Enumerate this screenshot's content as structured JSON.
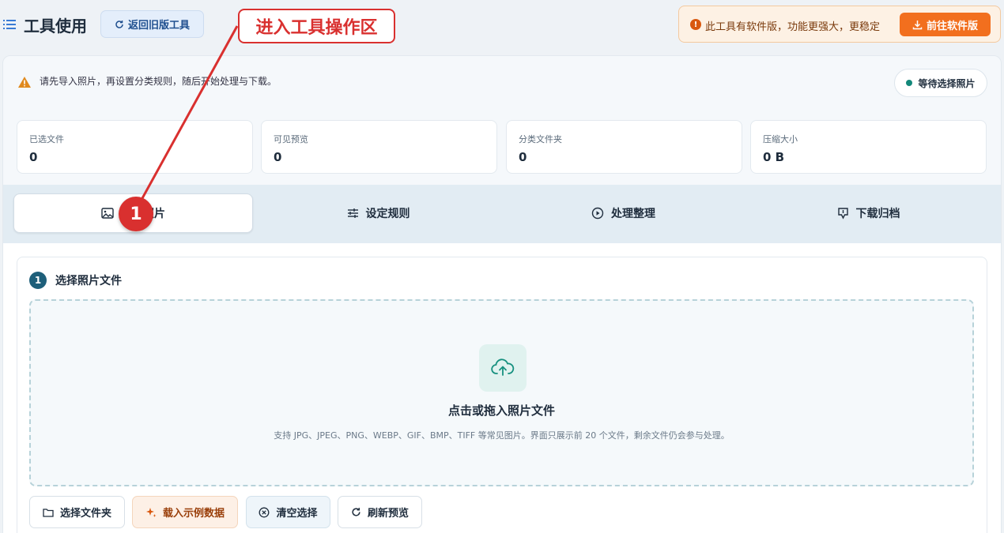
{
  "header": {
    "title": "工具使用",
    "back_label": "返回旧版工具",
    "promo_text": "此工具有软件版，功能更强大，更稳定",
    "promo_button": "前往软件版"
  },
  "notice": {
    "text": "请先导入照片，再设置分类规则，随后开始处理与下载。",
    "status": "等待选择照片"
  },
  "stats": [
    {
      "label": "已选文件",
      "value": "0"
    },
    {
      "label": "可见预览",
      "value": "0"
    },
    {
      "label": "分类文件夹",
      "value": "0"
    },
    {
      "label": "压缩大小",
      "value": "0 B"
    }
  ],
  "tabs": [
    {
      "label": "导入照片",
      "icon": "image-icon",
      "active": true
    },
    {
      "label": "设定规则",
      "icon": "sliders-icon"
    },
    {
      "label": "处理整理",
      "icon": "play-circle-icon"
    },
    {
      "label": "下载归档",
      "icon": "download-icon"
    }
  ],
  "section": {
    "step": "1",
    "title": "选择照片文件",
    "drop_title": "点击或拖入照片文件",
    "drop_hint": "支持 JPG、JPEG、PNG、WEBP、GIF、BMP、TIFF 等常见图片。界面只展示前 20 个文件，剩余文件仍会参与处理。"
  },
  "buttons": {
    "select_folder": "选择文件夹",
    "load_sample": "载入示例数据",
    "clear": "清空选择",
    "refresh": "刷新预览"
  },
  "annotation": {
    "label": "进入工具操作区",
    "marker": "1"
  },
  "colors": {
    "accent": "#1e5f7a",
    "promo": "#f26f1e",
    "annotation": "#d9302f"
  }
}
